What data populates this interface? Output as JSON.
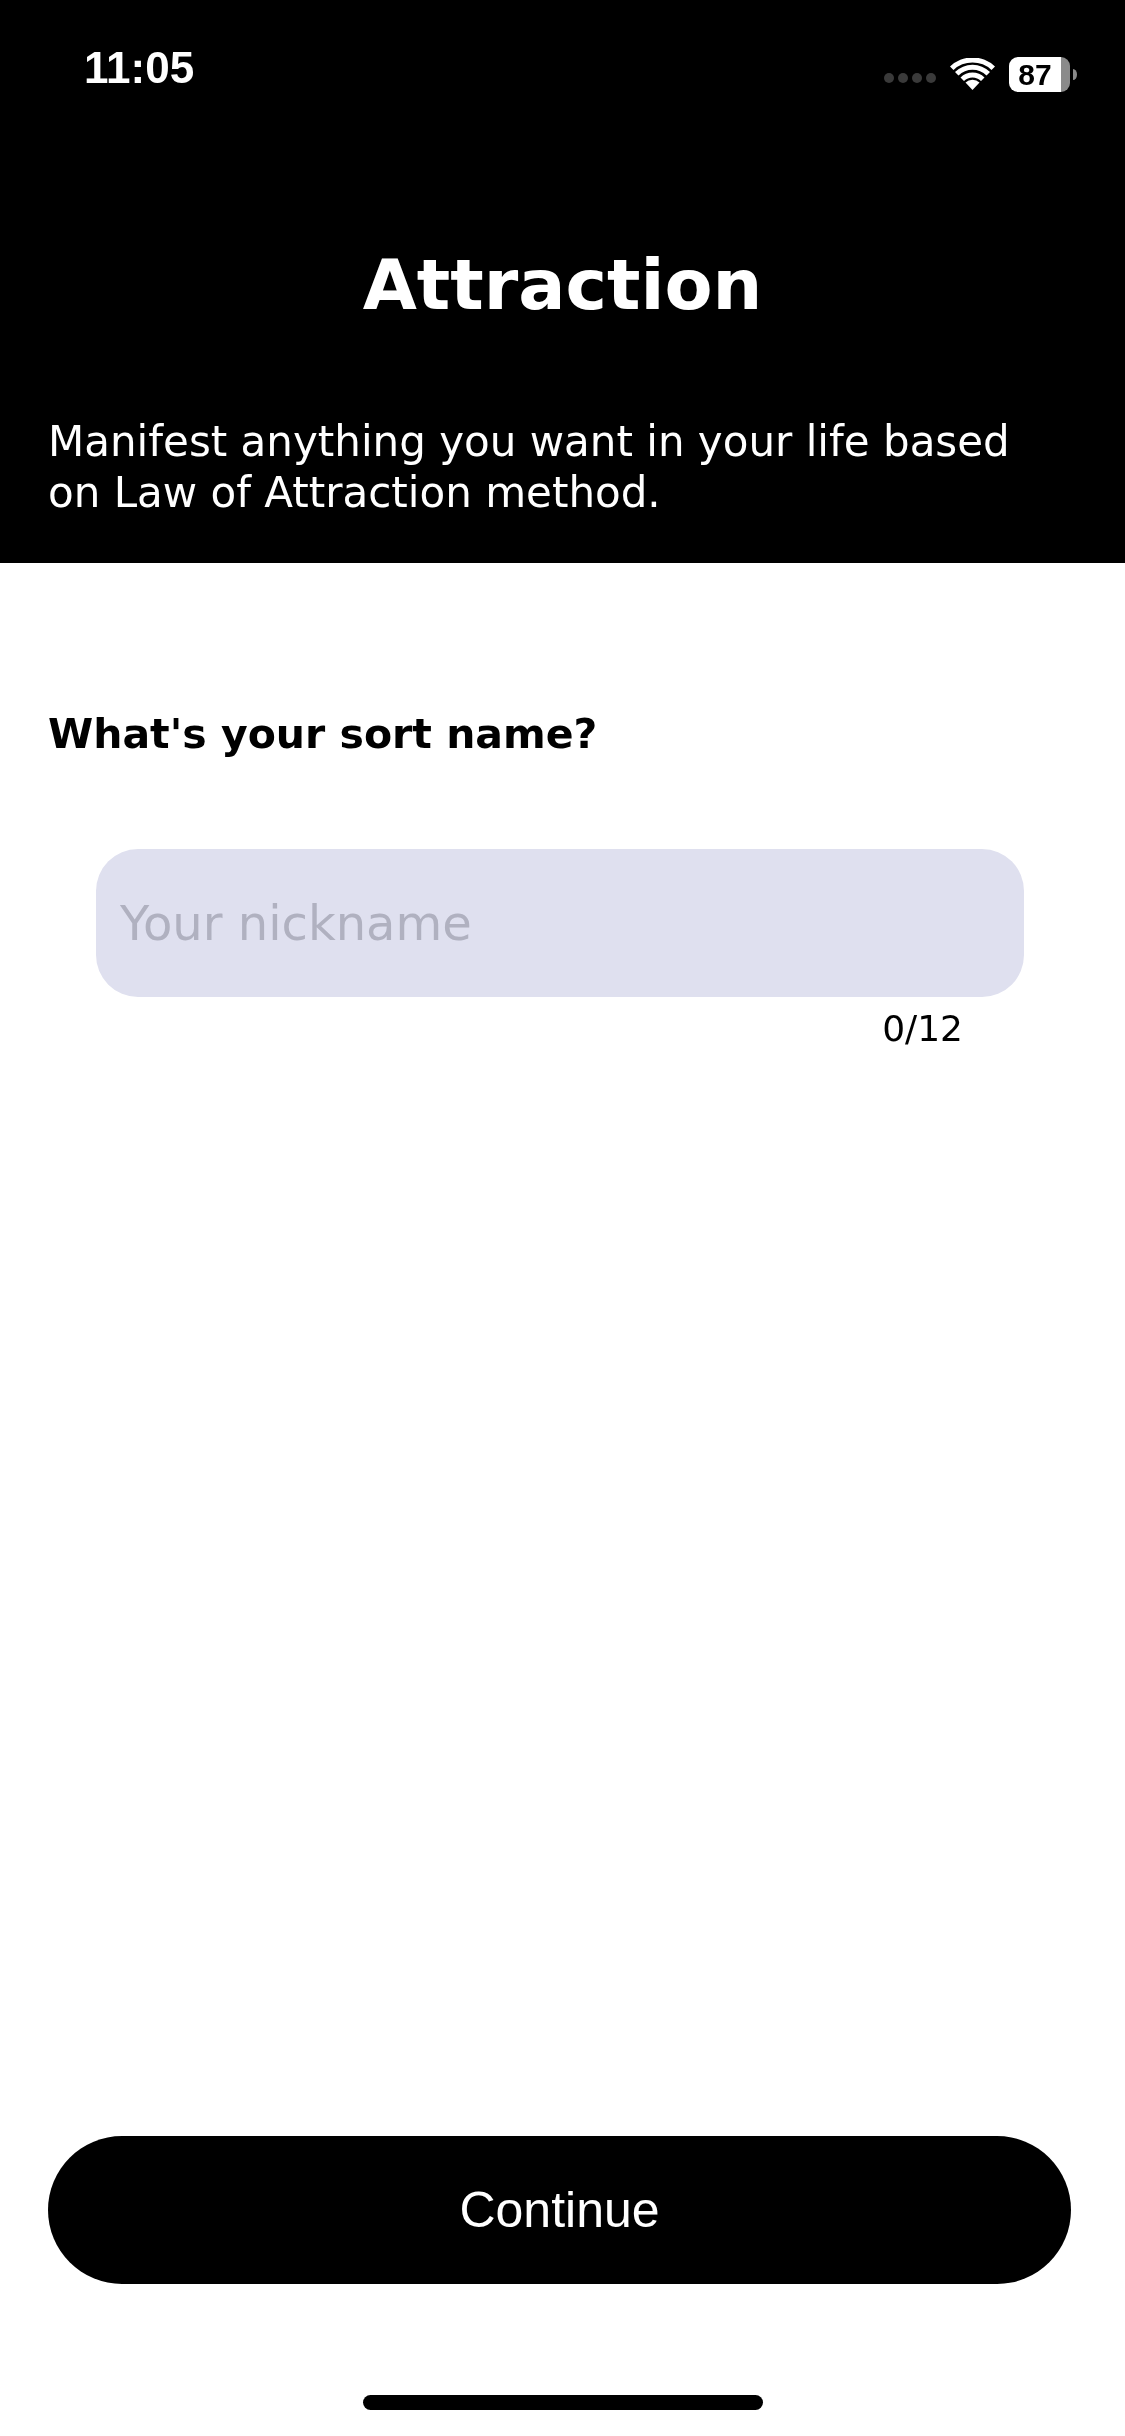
{
  "status_bar": {
    "time": "11:05",
    "battery": "87"
  },
  "header": {
    "title": "Attraction",
    "subtitle": "Manifest anything you want in your life based on Law of Attraction method."
  },
  "form": {
    "question": "What's your sort name?",
    "field": {
      "placeholder": "Your nickname",
      "counter": "0/12"
    }
  },
  "primary_button": {
    "label": "Continue"
  }
}
